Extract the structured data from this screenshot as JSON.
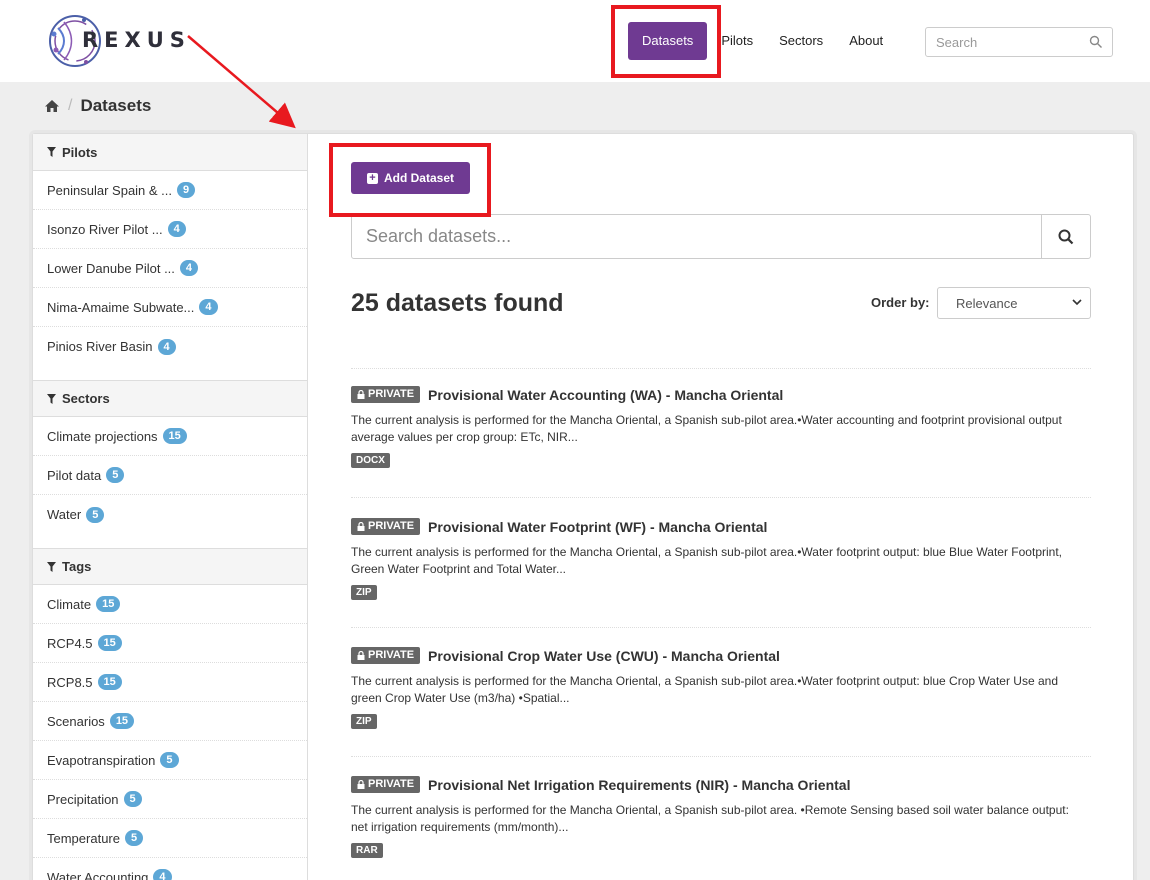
{
  "brand": {
    "logo_text": "REXUS"
  },
  "nav": {
    "items": [
      {
        "label": "Datasets",
        "active": true
      },
      {
        "label": "Pilots"
      },
      {
        "label": "Sectors"
      },
      {
        "label": "About"
      }
    ],
    "search_placeholder": "Search"
  },
  "breadcrumb": {
    "current": "Datasets"
  },
  "facets": {
    "pilots": {
      "title": "Pilots",
      "items": [
        {
          "label": "Peninsular Spain & ...",
          "count": "9"
        },
        {
          "label": "Isonzo River Pilot ...",
          "count": "4"
        },
        {
          "label": "Lower Danube Pilot ...",
          "count": "4"
        },
        {
          "label": "Nima-Amaime Subwate...",
          "count": "4"
        },
        {
          "label": "Pinios River Basin",
          "count": "4"
        }
      ]
    },
    "sectors": {
      "title": "Sectors",
      "items": [
        {
          "label": "Climate projections",
          "count": "15"
        },
        {
          "label": "Pilot data",
          "count": "5"
        },
        {
          "label": "Water",
          "count": "5"
        }
      ]
    },
    "tags": {
      "title": "Tags",
      "items": [
        {
          "label": "Climate",
          "count": "15"
        },
        {
          "label": "RCP4.5",
          "count": "15"
        },
        {
          "label": "RCP8.5",
          "count": "15"
        },
        {
          "label": "Scenarios",
          "count": "15"
        },
        {
          "label": "Evapotranspiration",
          "count": "5"
        },
        {
          "label": "Precipitation",
          "count": "5"
        },
        {
          "label": "Temperature",
          "count": "5"
        },
        {
          "label": "Water Accounting",
          "count": "4"
        }
      ]
    }
  },
  "content": {
    "add_button": "Add Dataset",
    "search_placeholder": "Search datasets...",
    "results_title": "25 datasets found",
    "order_label": "Order by:",
    "order_value": "Relevance"
  },
  "datasets": [
    {
      "badge": "PRIVATE",
      "title": "Provisional Water Accounting (WA) - Mancha Oriental",
      "description": "The current analysis is performed for the Mancha Oriental, a Spanish sub-pilot area.•Water accounting and footprint provisional output average values per crop group: ETc, NIR...",
      "format": "DOCX"
    },
    {
      "badge": "PRIVATE",
      "title": "Provisional Water Footprint (WF) - Mancha Oriental",
      "description": "The current analysis is performed for the Mancha Oriental, a Spanish sub-pilot area.•Water footprint output: blue Blue Water Footprint, Green Water Footprint and Total Water...",
      "format": "ZIP"
    },
    {
      "badge": "PRIVATE",
      "title": "Provisional Crop Water Use (CWU) - Mancha Oriental",
      "description": "The current analysis is performed for the Mancha Oriental, a Spanish sub-pilot area.•Water footprint output: blue Crop Water Use and green Crop Water Use (m3/ha) •Spatial...",
      "format": "ZIP"
    },
    {
      "badge": "PRIVATE",
      "title": "Provisional Net Irrigation Requirements (NIR) - Mancha Oriental",
      "description": "The current analysis is performed for the Mancha Oriental, a Spanish sub-pilot area. •Remote Sensing based soil water balance output: net irrigation requirements (mm/month)...",
      "format": "RAR"
    }
  ],
  "colors": {
    "primary": "#6f3a92",
    "badge": "#5da7d6",
    "annotation": "#e8191f"
  }
}
